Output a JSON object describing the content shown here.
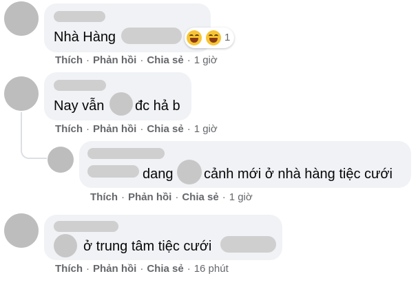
{
  "comments": [
    {
      "text_before": "Nhà Hàng",
      "reaction_count": "1",
      "actions": {
        "like": "Thích",
        "reply": "Phản hồi",
        "share": "Chia sẻ",
        "time": "1 giờ"
      }
    },
    {
      "text_before": "Nay vẫn",
      "text_after": "đc hả b",
      "actions": {
        "like": "Thích",
        "reply": "Phản hồi",
        "share": "Chia sẻ",
        "time": "1 giờ"
      }
    },
    {
      "text_middle": "dang",
      "text_after": "cảnh mới ở nhà hàng tiệc cưới",
      "actions": {
        "like": "Thích",
        "reply": "Phản hồi",
        "share": "Chia sẻ",
        "time": "1 giờ"
      }
    },
    {
      "text_after": "ở trung tâm tiệc cưới",
      "actions": {
        "like": "Thích",
        "reply": "Phản hồi",
        "share": "Chia sẻ",
        "time": "16 phút"
      }
    }
  ],
  "separator": "·",
  "colors": {
    "bubble": "#f0f2f5",
    "meta_text": "#65676b",
    "body_text": "#050505"
  }
}
